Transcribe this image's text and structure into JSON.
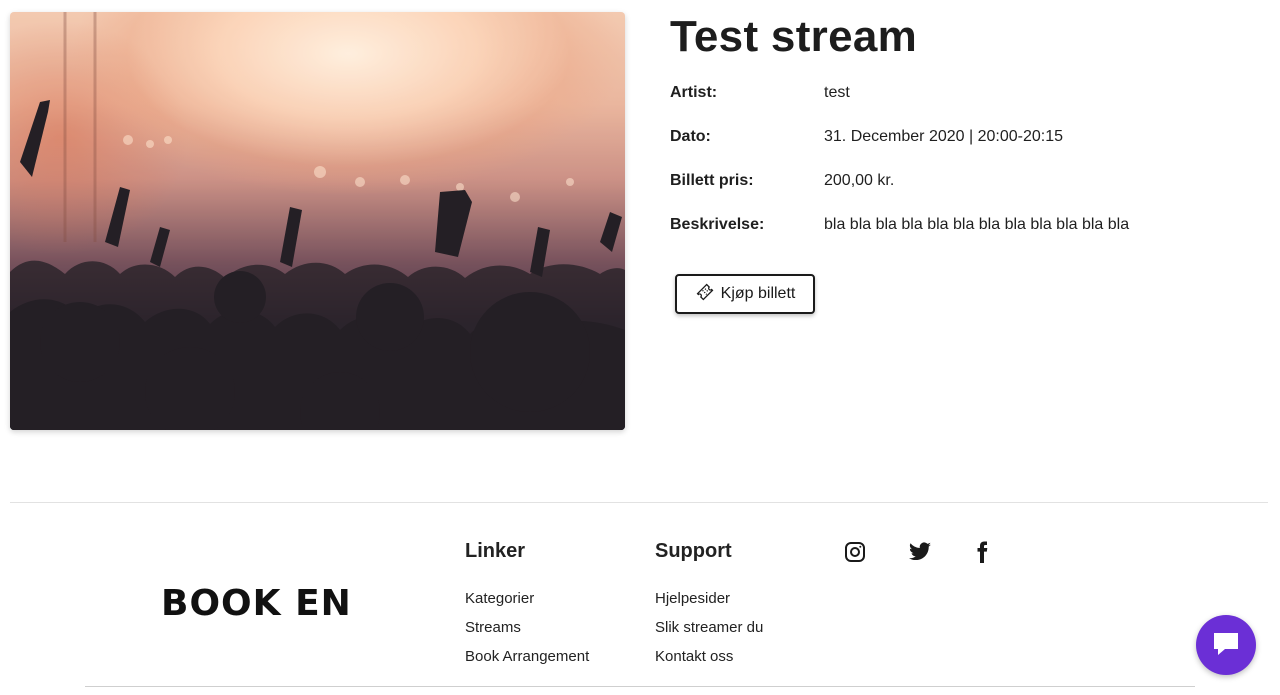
{
  "event": {
    "title": "Test stream",
    "fields": [
      {
        "label": "Artist:",
        "value": "test"
      },
      {
        "label": "Dato:",
        "value": "31. December 2020 | 20:00-20:15"
      },
      {
        "label": "Billett pris:",
        "value": "200,00 kr."
      },
      {
        "label": "Beskrivelse:",
        "value": "bla bla bla bla bla bla bla bla bla bla bla bla"
      }
    ],
    "buy_button_label": "Kjøp billett",
    "buy_button_icon": "ticket-icon"
  },
  "footer": {
    "logo_text": "BOOK EN",
    "links_title": "Linker",
    "links": [
      "Kategorier",
      "Streams",
      "Book Arrangement"
    ],
    "support_title": "Support",
    "support_links": [
      "Hjelpesider",
      "Slik streamer du",
      "Kontakt oss"
    ],
    "social_icons": [
      "instagram-icon",
      "twitter-icon",
      "facebook-icon"
    ]
  },
  "chat": {
    "icon": "chat-icon",
    "color": "#6b2fd6"
  }
}
